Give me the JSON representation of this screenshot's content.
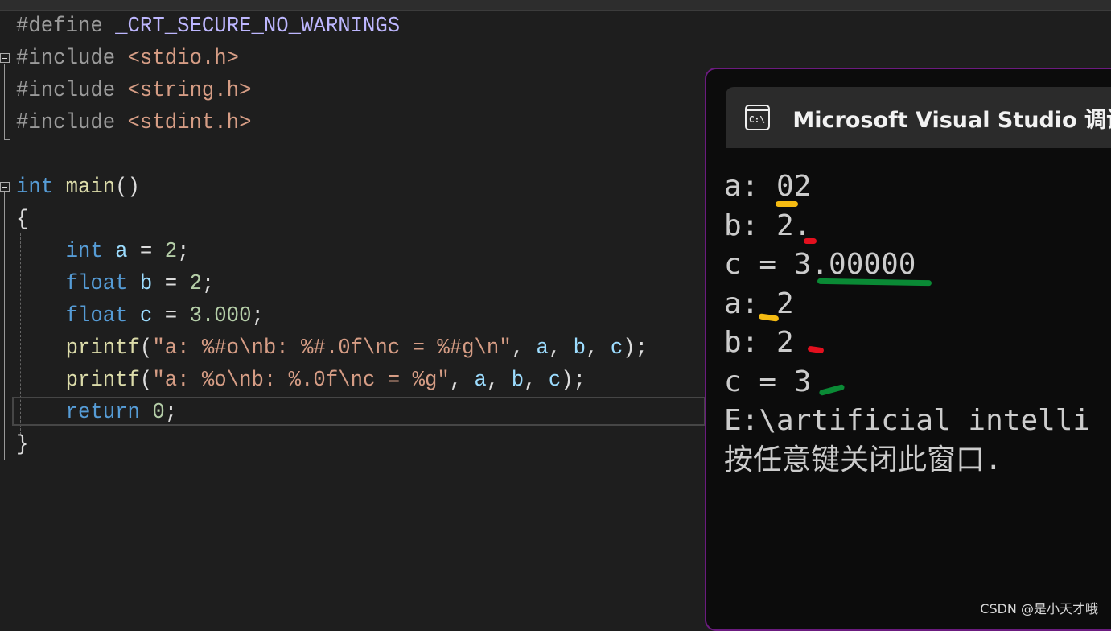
{
  "editor": {
    "colors": {
      "pre": "#9b9b9b",
      "macro": "#beb7ff",
      "str": "#d69d85",
      "kw": "#569cd6",
      "fn": "#dcdcaa",
      "var": "#9cdcfe",
      "num": "#b5cea8",
      "plain": "#dcdcdc",
      "esc": "#e8c9bb"
    },
    "lines": [
      [
        [
          "pre",
          "#define "
        ],
        [
          "macro",
          "_CRT_SECURE_NO_WARNINGS"
        ]
      ],
      [
        [
          "pre",
          "#include "
        ],
        [
          "str",
          "<stdio.h>"
        ]
      ],
      [
        [
          "pre",
          "#include "
        ],
        [
          "str",
          "<string.h>"
        ]
      ],
      [
        [
          "pre",
          "#include "
        ],
        [
          "str",
          "<stdint.h>"
        ]
      ],
      [],
      [
        [
          "kw",
          "int"
        ],
        [
          "plain",
          " "
        ],
        [
          "fn",
          "main"
        ],
        [
          "plain",
          "()"
        ]
      ],
      [
        [
          "plain",
          "{"
        ]
      ],
      [
        [
          "plain",
          "    "
        ],
        [
          "kw",
          "int"
        ],
        [
          "plain",
          " "
        ],
        [
          "var",
          "a"
        ],
        [
          "plain",
          " = "
        ],
        [
          "num",
          "2"
        ],
        [
          "plain",
          ";"
        ]
      ],
      [
        [
          "plain",
          "    "
        ],
        [
          "kw",
          "float"
        ],
        [
          "plain",
          " "
        ],
        [
          "var",
          "b"
        ],
        [
          "plain",
          " = "
        ],
        [
          "num",
          "2"
        ],
        [
          "plain",
          ";"
        ]
      ],
      [
        [
          "plain",
          "    "
        ],
        [
          "kw",
          "float"
        ],
        [
          "plain",
          " "
        ],
        [
          "var",
          "c"
        ],
        [
          "plain",
          " = "
        ],
        [
          "num",
          "3.000"
        ],
        [
          "plain",
          ";"
        ]
      ],
      [
        [
          "plain",
          "    "
        ],
        [
          "fn",
          "printf"
        ],
        [
          "plain",
          "("
        ],
        [
          "str",
          "\"a: %#o\\nb: %#.0f\\nc = %#g\\n\""
        ],
        [
          "plain",
          ", "
        ],
        [
          "var",
          "a"
        ],
        [
          "plain",
          ", "
        ],
        [
          "var",
          "b"
        ],
        [
          "plain",
          ", "
        ],
        [
          "var",
          "c"
        ],
        [
          "plain",
          ");"
        ]
      ],
      [
        [
          "plain",
          "    "
        ],
        [
          "fn",
          "printf"
        ],
        [
          "plain",
          "("
        ],
        [
          "str",
          "\"a: %o\\nb: %.0f\\nc = %g\""
        ],
        [
          "plain",
          ", "
        ],
        [
          "var",
          "a"
        ],
        [
          "plain",
          ", "
        ],
        [
          "var",
          "b"
        ],
        [
          "plain",
          ", "
        ],
        [
          "var",
          "c"
        ],
        [
          "plain",
          ");"
        ]
      ],
      [
        [
          "plain",
          "    "
        ],
        [
          "kw",
          "return"
        ],
        [
          "plain",
          " "
        ],
        [
          "num",
          "0"
        ],
        [
          "plain",
          ";"
        ]
      ],
      [
        [
          "plain",
          "}"
        ]
      ]
    ]
  },
  "console": {
    "title": "Microsoft Visual Studio 调试",
    "icon": "cmd-icon",
    "icon_text": "C:\\",
    "output": [
      "a: 02",
      "b: 2.",
      "c = 3.00000",
      "a: 2",
      "b: 2",
      "c = 3",
      "E:\\artificial intelli",
      "按任意键关闭此窗口."
    ],
    "annotation_colors": {
      "yellow": "#f5bb12",
      "red": "#e3101e",
      "green": "#0a8a35"
    }
  },
  "watermark": "CSDN @是小天才哦"
}
